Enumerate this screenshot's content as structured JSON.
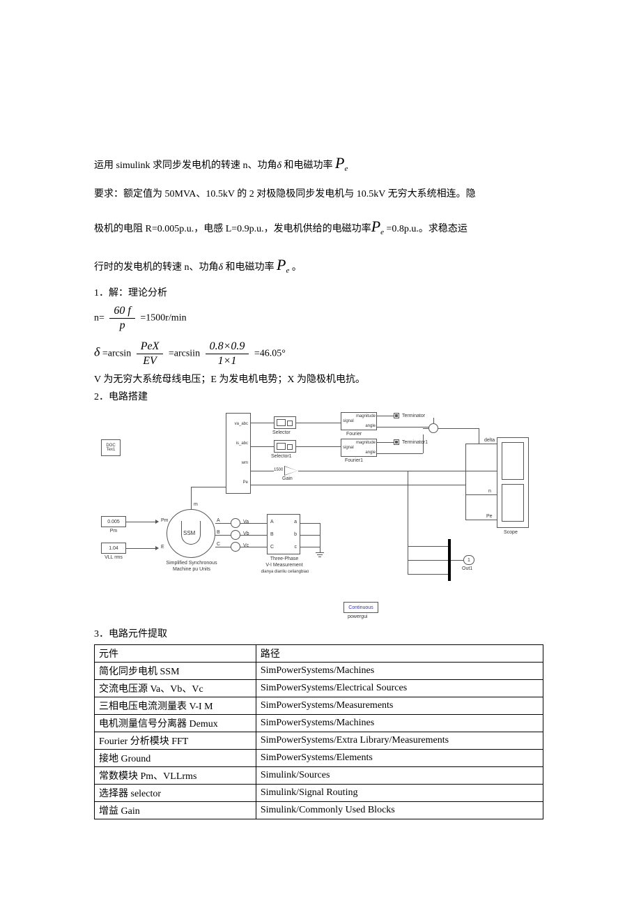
{
  "title_part1": "运用 simulink 求同步发电机的转速 n、功角",
  "title_part2": " 和电磁功率",
  "req_1": "要求：额定值为 50MVA、10.5kV 的 2 对极隐极同步发电机与 10.5kV 无穷大系统相连。隐",
  "req_2a": "极机的电阻 R=0.005p.u.，电感 L=0.9p.u.，发电机供给的电磁功率",
  "req_2b": " =0.8p.u.。求稳态运",
  "req_3a": "行时的发电机的转速 n、功角",
  "req_3b": " 和电磁功率",
  "req_3c": " 。",
  "s1": "1．解：理论分析",
  "n_eq_pre": "n= ",
  "n_frac_num": "60 f",
  "n_frac_den": "p",
  "n_eq_post": " =1500r/min",
  "d_pre": " =arcsin ",
  "d_frac1_num": "PeX",
  "d_frac1_den": "EV",
  "d_mid": " =arcsiin ",
  "d_frac2_num": "0.8×0.9",
  "d_frac2_den": "1×1",
  "d_post": " =46.05°",
  "note": "V 为无穷大系统母线电压；E 为发电机电势；X 为隐极机电抗。",
  "s2": "2．电路搭建",
  "s3": "3．电路元件提取",
  "diagram": {
    "doc": "DOC\nTex1",
    "pm_const": "0.005",
    "pm_lbl": "Pm",
    "pm_name": "Pm",
    "vll_const": "1.04",
    "vll_lbl": "VLL rms",
    "vll_name": "E",
    "ssm": "SSM",
    "ssm_lbl": "Simplified Synchronous\nMachine pu Units",
    "va": "Va",
    "vb": "Vb",
    "vc": "Vc",
    "meas_a": "A  a",
    "meas_b": "B  b",
    "meas_c": "C  c",
    "meas_lbl": "Three-Phase\nV-I Measurement",
    "meas_lbl2": "dianya dianliu celiangbiao",
    "sel1": "Selector",
    "sel2": "Selector1",
    "demux_va": "va_abc",
    "demux_is": "is_abc",
    "demux_wm": "wm",
    "demux_pe": "Pe",
    "demux_m": "m",
    "four_mag": "magnitude",
    "four_sig": "signal",
    "four_ang": "angle",
    "four1": "Fourier",
    "four2": "Fourier1",
    "term1": "Terminator",
    "term2": "Terminator1",
    "gain": "1500",
    "gain_lbl": "Gain",
    "sum": "+",
    "sub": "−",
    "out_d": "delta",
    "out_n": "n",
    "out_pe": "Pe",
    "scope": "Scope",
    "out1": "1",
    "out1_lbl": "Out1",
    "pg": "Continuous",
    "pg_lbl": "powergui"
  },
  "table": {
    "h1": "元件",
    "h2": "路径",
    "rows": [
      [
        "简化同步电机 SSM",
        "SimPowerSystems/Machines"
      ],
      [
        "交流电压源 Va、Vb、Vc",
        "SimPowerSystems/Electrical Sources"
      ],
      [
        "三相电压电流测量表 V-I M",
        "SimPowerSystems/Measurements"
      ],
      [
        "电机测量信号分离器 Demux",
        "SimPowerSystems/Machines"
      ],
      [
        "Fourier 分析模块 FFT",
        "SimPowerSystems/Extra Library/Measurements"
      ],
      [
        "接地 Ground",
        "SimPowerSystems/Elements"
      ],
      [
        "常数模块 Pm、VLLrms",
        "Simulink/Sources"
      ],
      [
        "选择器 selector",
        "Simulink/Signal Routing"
      ],
      [
        "增益 Gain",
        "Simulink/Commonly Used Blocks"
      ]
    ]
  }
}
